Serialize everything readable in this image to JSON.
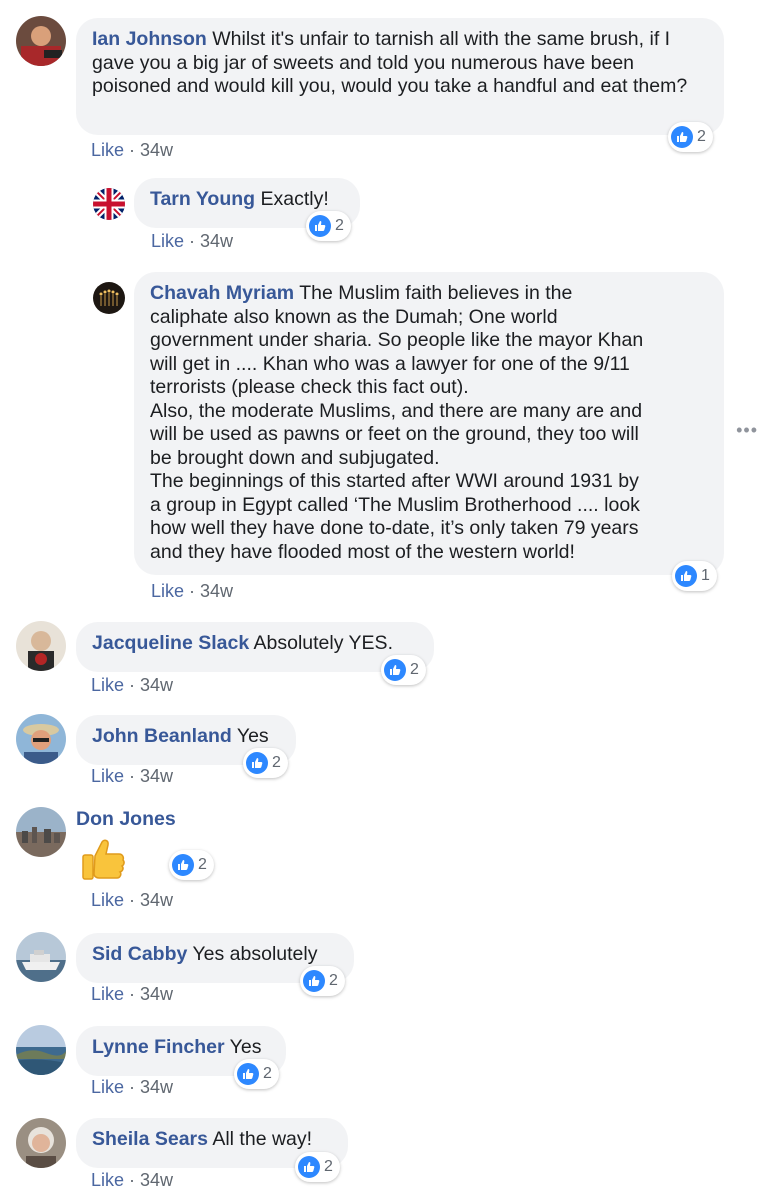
{
  "comments": [
    {
      "name": "Ian Johnson",
      "text": "Whilst it's unfair to tarnish all with the same brush, if I gave you a big jar of sweets and told you numerous have been poisoned and would kill you, would you take a handful and eat them?",
      "like": "Like",
      "time": "34w",
      "reactions": "2"
    },
    {
      "name": "Tarn Young",
      "text": "Exactly!",
      "like": "Like",
      "time": "34w",
      "reactions": "2"
    },
    {
      "name": "Chavah Myriam",
      "text_lines": [
        "The Muslim faith believes in the",
        "caliphate also known as the Dumah; One world",
        "government under sharia. So people like the mayor Khan",
        "will get in .... Khan who was a lawyer for one of the 9/11",
        "terrorists (please check this fact out).",
        "Also, the moderate Muslims, and there are many are and",
        "will be used as pawns or feet on the ground, they too will",
        "be brought down and subjugated.",
        "The beginnings of this started after WWI around 1931 by",
        "a group in Egypt called ‘The Muslim Brotherhood .... look",
        "how well they have done to-date, it’s only taken 79 years",
        "and they have flooded most of the western world!"
      ],
      "like": "Like",
      "time": "34w",
      "reactions": "1"
    },
    {
      "name": "Jacqueline Slack",
      "text": "Absolutely YES.",
      "like": "Like",
      "time": "34w",
      "reactions": "2"
    },
    {
      "name": "John Beanland",
      "text": "Yes",
      "like": "Like",
      "time": "34w",
      "reactions": "2"
    },
    {
      "name": "Don Jones",
      "text": "",
      "like": "Like",
      "time": "34w",
      "reactions": "2"
    },
    {
      "name": "Sid Cabby",
      "text": "Yes absolutely",
      "like": "Like",
      "time": "34w",
      "reactions": "2"
    },
    {
      "name": "Lynne Fincher",
      "text": "Yes",
      "like": "Like",
      "time": "34w",
      "reactions": "2"
    },
    {
      "name": "Sheila Sears",
      "text": "All the way!",
      "like": "Like",
      "time": "34w",
      "reactions": "2"
    }
  ],
  "colors": {
    "name": "#385898",
    "bubble": "#f2f3f5",
    "reaction": "#2d88ff"
  },
  "icons": {
    "reaction": "thumbs-up-icon",
    "more": "more-options-icon",
    "emoji": "thumbs-up-emoji"
  }
}
